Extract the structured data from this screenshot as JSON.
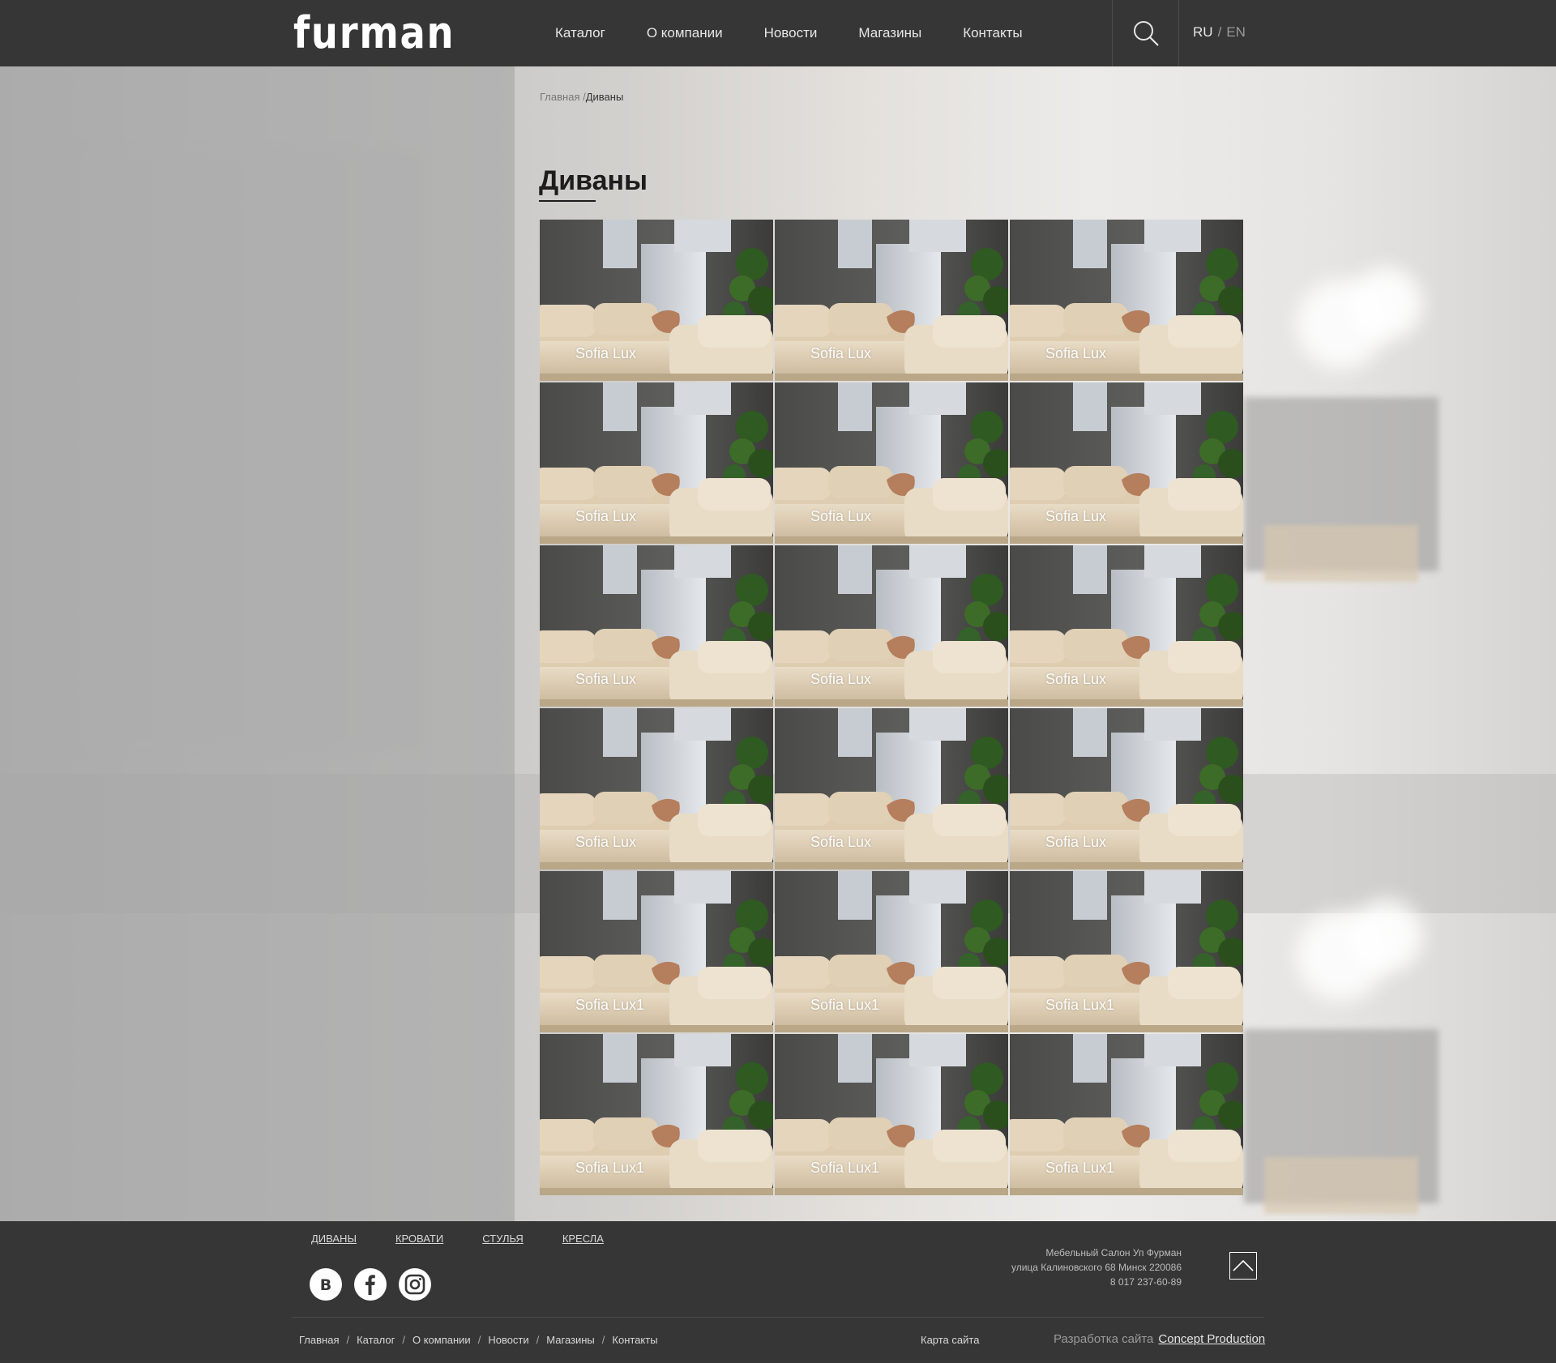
{
  "header": {
    "logo": "furman",
    "nav": [
      "Каталог",
      "О компании",
      "Новости",
      "Магазины",
      "Контакты"
    ],
    "search_icon": "search-icon",
    "lang": {
      "ru": "RU",
      "separator": "/",
      "en": "EN"
    }
  },
  "breadcrumb": {
    "home": "Главная /",
    "current": "Диваны"
  },
  "page_title": "Диваны",
  "products": [
    {
      "label": "Sofia Lux"
    },
    {
      "label": "Sofia Lux"
    },
    {
      "label": "Sofia Lux"
    },
    {
      "label": "Sofia Lux"
    },
    {
      "label": "Sofia Lux"
    },
    {
      "label": "Sofia Lux"
    },
    {
      "label": "Sofia Lux"
    },
    {
      "label": "Sofia Lux"
    },
    {
      "label": "Sofia Lux"
    },
    {
      "label": "Sofia Lux"
    },
    {
      "label": "Sofia Lux"
    },
    {
      "label": "Sofia Lux"
    },
    {
      "label": "Sofia Lux1"
    },
    {
      "label": "Sofia Lux1"
    },
    {
      "label": "Sofia Lux1"
    },
    {
      "label": "Sofia Lux1"
    },
    {
      "label": "Sofia Lux1"
    },
    {
      "label": "Sofia Lux1"
    }
  ],
  "footer": {
    "categories": [
      "ДИВАНЫ",
      "КРОВАТИ",
      "СТУЛЬЯ",
      "КРЕСЛА"
    ],
    "socials": [
      "vk-icon",
      "facebook-icon",
      "instagram-icon"
    ],
    "company": {
      "name": "Мебельный Салон Уп Фурман",
      "address": "улица Калиновского 68 Минск 220086",
      "phone": "8 017 237-60-89"
    },
    "to_top_icon": "chevron-up-icon",
    "nav": [
      "Главная",
      "Каталог",
      "О компании",
      "Новости",
      "Магазины",
      "Контакты"
    ],
    "nav_separator": "/",
    "sitemap": "Карта сайта",
    "dev_label": "Разработка сайта",
    "dev_link": "Concept Production"
  }
}
